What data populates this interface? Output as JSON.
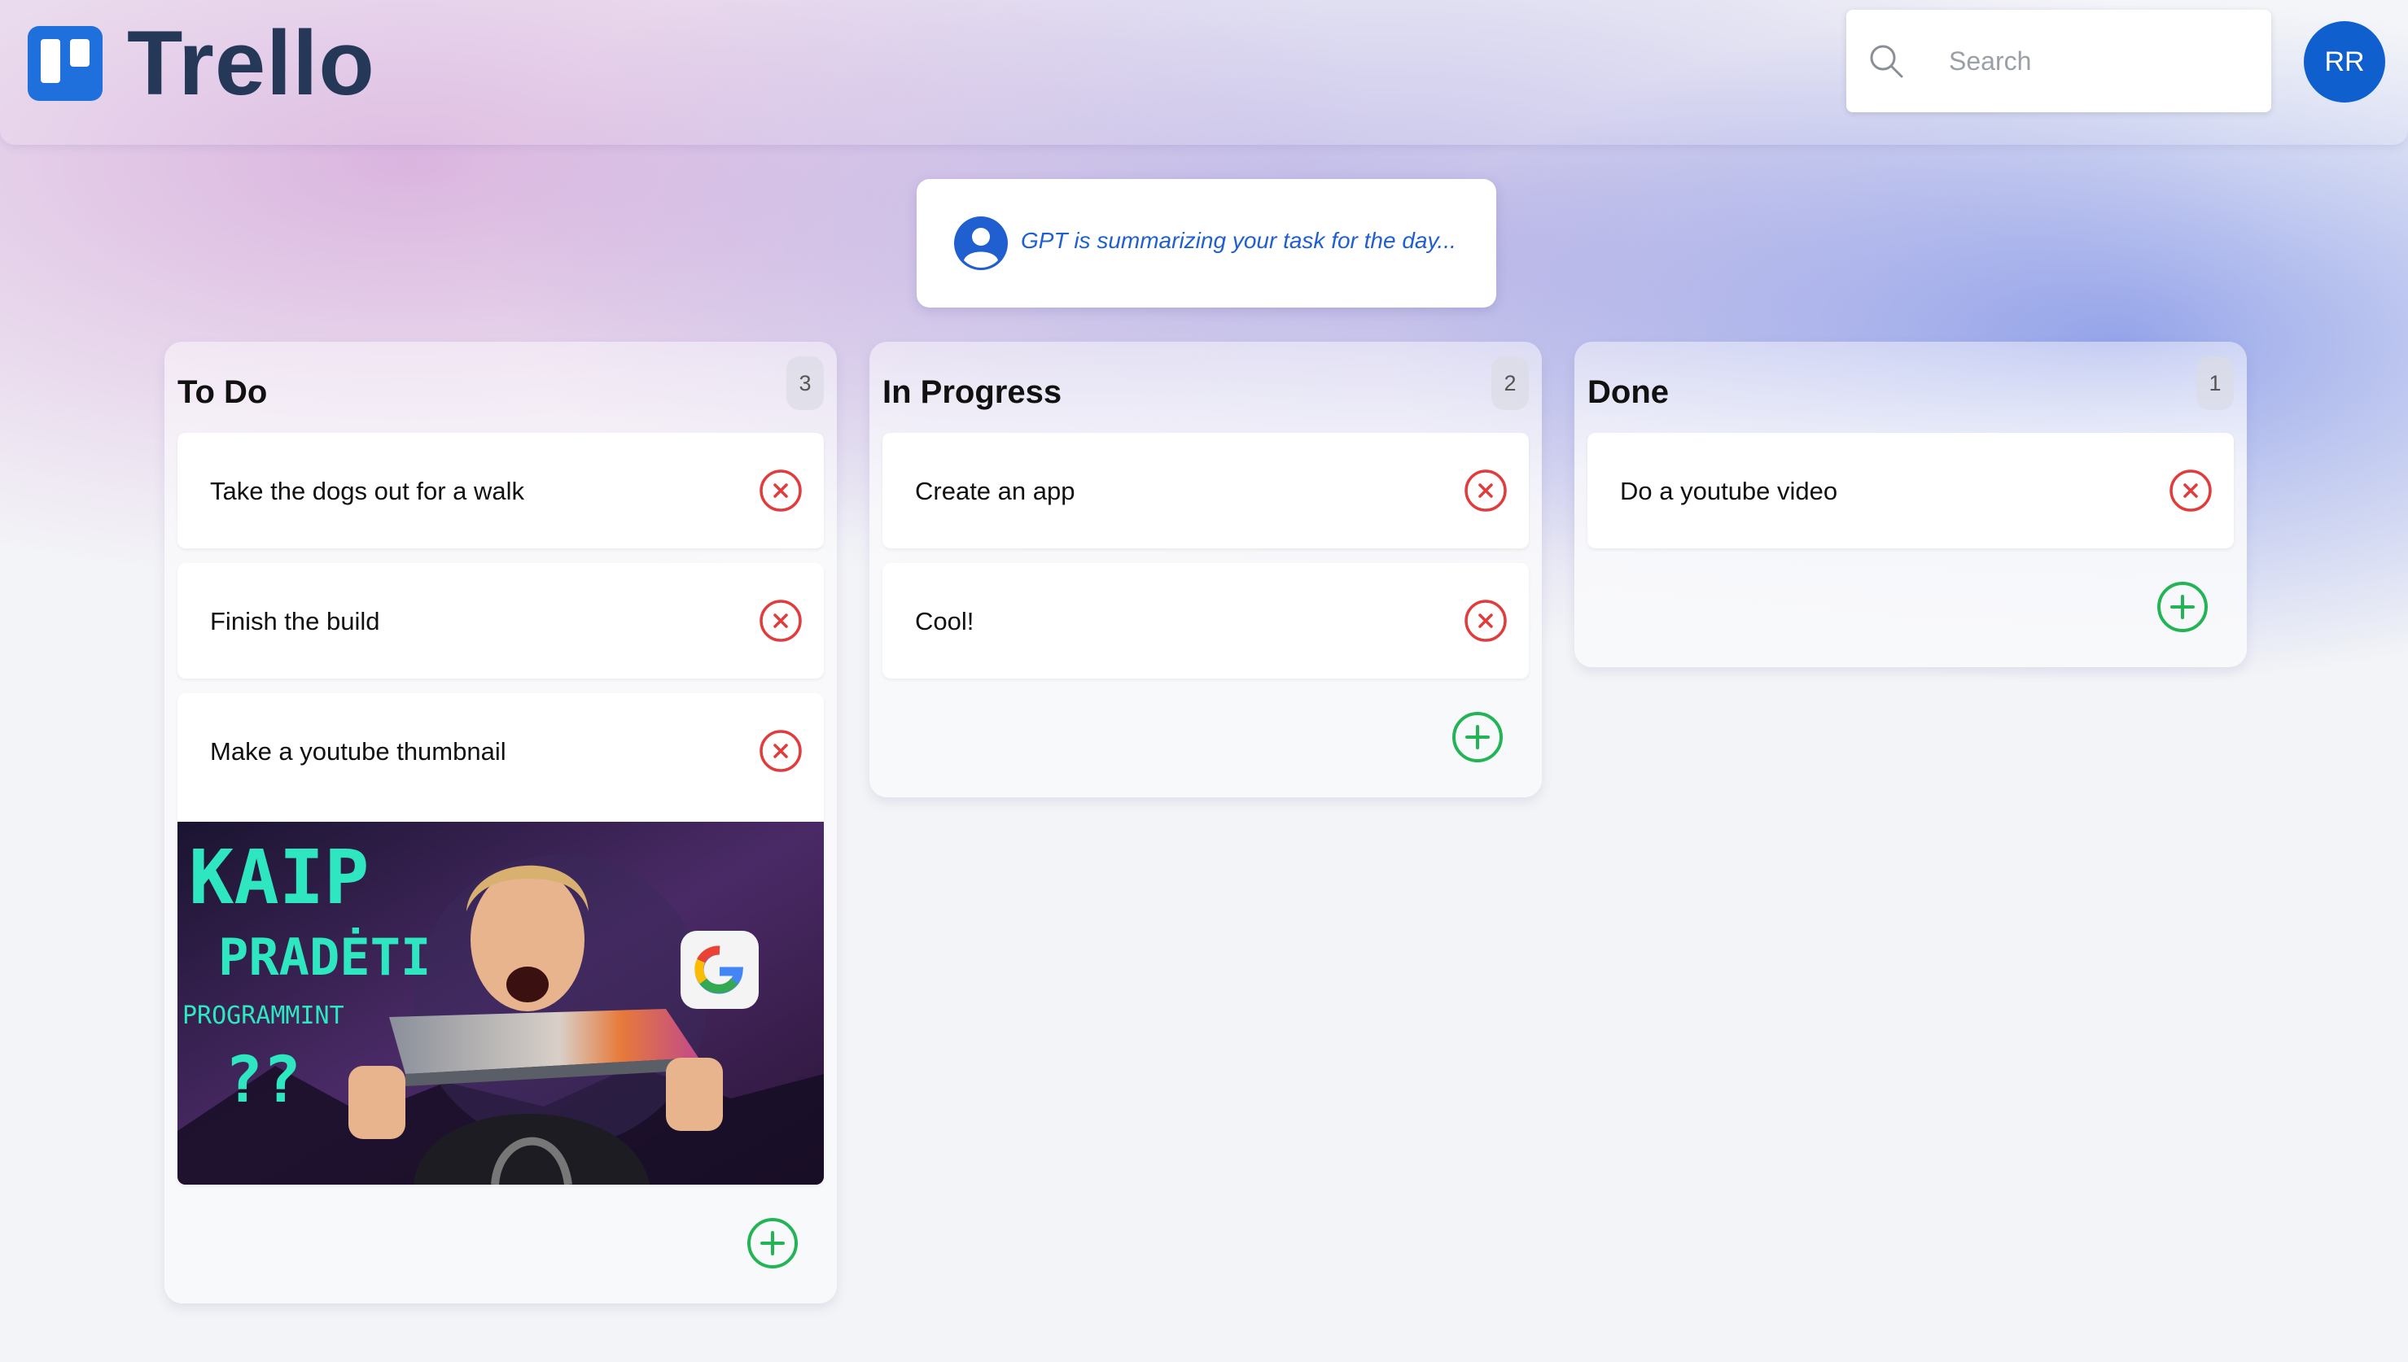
{
  "header": {
    "app_name": "Trello",
    "search": {
      "placeholder": "Search"
    },
    "user_initials": "RR"
  },
  "gpt_status": "GPT is summarizing your task for the day...",
  "columns": [
    {
      "title": "To Do",
      "count": "3",
      "cards": [
        {
          "text": "Take the dogs out for a walk"
        },
        {
          "text": "Finish the build"
        },
        {
          "text": "Make a youtube thumbnail",
          "image": {
            "line1": "KAIP",
            "line2": "PRADĖTI",
            "line3": "PROGRAMMINT",
            "line4": "??"
          }
        }
      ]
    },
    {
      "title": "In Progress",
      "count": "2",
      "cards": [
        {
          "text": "Create an app"
        },
        {
          "text": "Cool!"
        }
      ]
    },
    {
      "title": "Done",
      "count": "1",
      "cards": [
        {
          "text": "Do a youtube video"
        }
      ]
    }
  ],
  "colors": {
    "logo": "#1f6fdc",
    "logo_text": "#253858",
    "avatar": "#0f5fce",
    "gpt_text": "#1f5fd0",
    "delete": "#e23b3b",
    "add": "#22b455"
  },
  "icons": {
    "delete": "close-circle-icon",
    "add": "plus-circle-icon",
    "search": "search-icon",
    "gpt": "user-circle-icon"
  }
}
